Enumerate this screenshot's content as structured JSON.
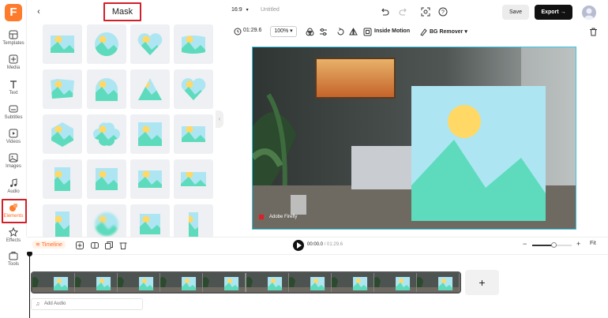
{
  "app": {
    "logo_letter": "F"
  },
  "rail": {
    "items": [
      {
        "key": "templates",
        "label": "Templates",
        "icon": "templates-icon"
      },
      {
        "key": "media",
        "label": "Media",
        "icon": "media-icon"
      },
      {
        "key": "text",
        "label": "Text",
        "icon": "text-icon"
      },
      {
        "key": "subtitles",
        "label": "Subtitles",
        "icon": "subtitles-icon"
      },
      {
        "key": "videos",
        "label": "Videos",
        "icon": "videos-icon"
      },
      {
        "key": "images",
        "label": "Images",
        "icon": "images-icon"
      },
      {
        "key": "audio",
        "label": "Audio",
        "icon": "audio-icon"
      },
      {
        "key": "elements",
        "label": "Elements",
        "icon": "elements-icon",
        "active": true
      },
      {
        "key": "effects",
        "label": "Effects",
        "icon": "effects-icon"
      },
      {
        "key": "tools",
        "label": "Tools",
        "icon": "tools-icon"
      }
    ]
  },
  "panel": {
    "title": "Mask",
    "back_icon": "chevron-left-icon",
    "mask_shapes": [
      "rectangle",
      "circle",
      "heart",
      "wave-rectangle",
      "rectangle-frame",
      "arch",
      "triangle",
      "heart",
      "hexagon",
      "flower",
      "square-tall",
      "square-short",
      "portrait-small",
      "square",
      "landscape",
      "landscape-wide",
      "portrait-tall",
      "blurred-circle",
      "square-small",
      "narrow-tall"
    ]
  },
  "topbar": {
    "ratio": "16:9",
    "doc_title": "Untitled",
    "save_label": "Save",
    "export_label": "Export",
    "icons": [
      "undo-icon",
      "redo-icon",
      "screen-capture-icon",
      "help-icon"
    ]
  },
  "edit_toolbar": {
    "duration": "01:29.6",
    "zoom": "100%",
    "inside_motion": "Inside Motion",
    "bg_remover": "BG Remover"
  },
  "canvas": {
    "watermark": "Adobe Firefly",
    "colors": {
      "selection": "#38c6e6",
      "mask_sky": "#ade6f2",
      "mask_sun": "#ffd866",
      "mask_hills": "#5ddbbc"
    }
  },
  "timeline": {
    "tab_label": "Timeline",
    "current_time": "00:00.0",
    "total_time": "01:29.6",
    "zoom_fraction": 0.55,
    "fit_label": "Fit",
    "add_clip_label": "+",
    "add_audio_label": "Add Audio",
    "clip_count": 10
  }
}
